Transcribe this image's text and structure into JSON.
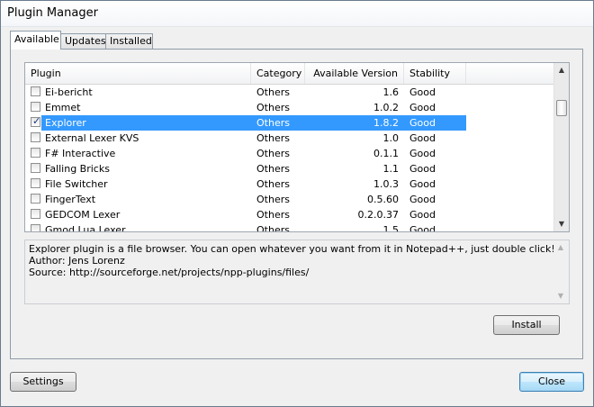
{
  "window": {
    "title": "Plugin Manager"
  },
  "tabs": [
    {
      "label": "Available",
      "active": true
    },
    {
      "label": "Updates",
      "active": false
    },
    {
      "label": "Installed",
      "active": false
    }
  ],
  "table": {
    "columns": [
      "Plugin",
      "Category",
      "Available Version",
      "Stability"
    ],
    "rows": [
      {
        "name": "Ei-bericht",
        "category": "Others",
        "version": "1.6",
        "stability": "Good",
        "checked": false,
        "selected": false
      },
      {
        "name": "Emmet",
        "category": "Others",
        "version": "1.0.2",
        "stability": "Good",
        "checked": false,
        "selected": false
      },
      {
        "name": "Explorer",
        "category": "Others",
        "version": "1.8.2",
        "stability": "Good",
        "checked": true,
        "selected": true
      },
      {
        "name": "External Lexer KVS",
        "category": "Others",
        "version": "1.0",
        "stability": "Good",
        "checked": false,
        "selected": false
      },
      {
        "name": "F# Interactive",
        "category": "Others",
        "version": "0.1.1",
        "stability": "Good",
        "checked": false,
        "selected": false
      },
      {
        "name": "Falling Bricks",
        "category": "Others",
        "version": "1.1",
        "stability": "Good",
        "checked": false,
        "selected": false
      },
      {
        "name": "File Switcher",
        "category": "Others",
        "version": "1.0.3",
        "stability": "Good",
        "checked": false,
        "selected": false
      },
      {
        "name": "FingerText",
        "category": "Others",
        "version": "0.5.60",
        "stability": "Good",
        "checked": false,
        "selected": false
      },
      {
        "name": "GEDCOM Lexer",
        "category": "Others",
        "version": "0.2.0.37",
        "stability": "Good",
        "checked": false,
        "selected": false
      },
      {
        "name": "Gmod Lua Lexer",
        "category": "Others",
        "version": "1.5",
        "stability": "Good",
        "checked": false,
        "selected": false
      }
    ]
  },
  "description": {
    "lines": [
      "Explorer plugin is a file browser. You can open whatever you want from it in Notepad++, just double click!",
      "Author: Jens Lorenz",
      "Source: http://sourceforge.net/projects/npp-plugins/files/"
    ]
  },
  "buttons": {
    "install": "Install",
    "settings": "Settings",
    "close": "Close"
  },
  "icons": {
    "scroll_up": "scroll-up-arrow-icon",
    "scroll_down": "scroll-down-arrow-icon",
    "checkmark": "checkmark-icon"
  }
}
